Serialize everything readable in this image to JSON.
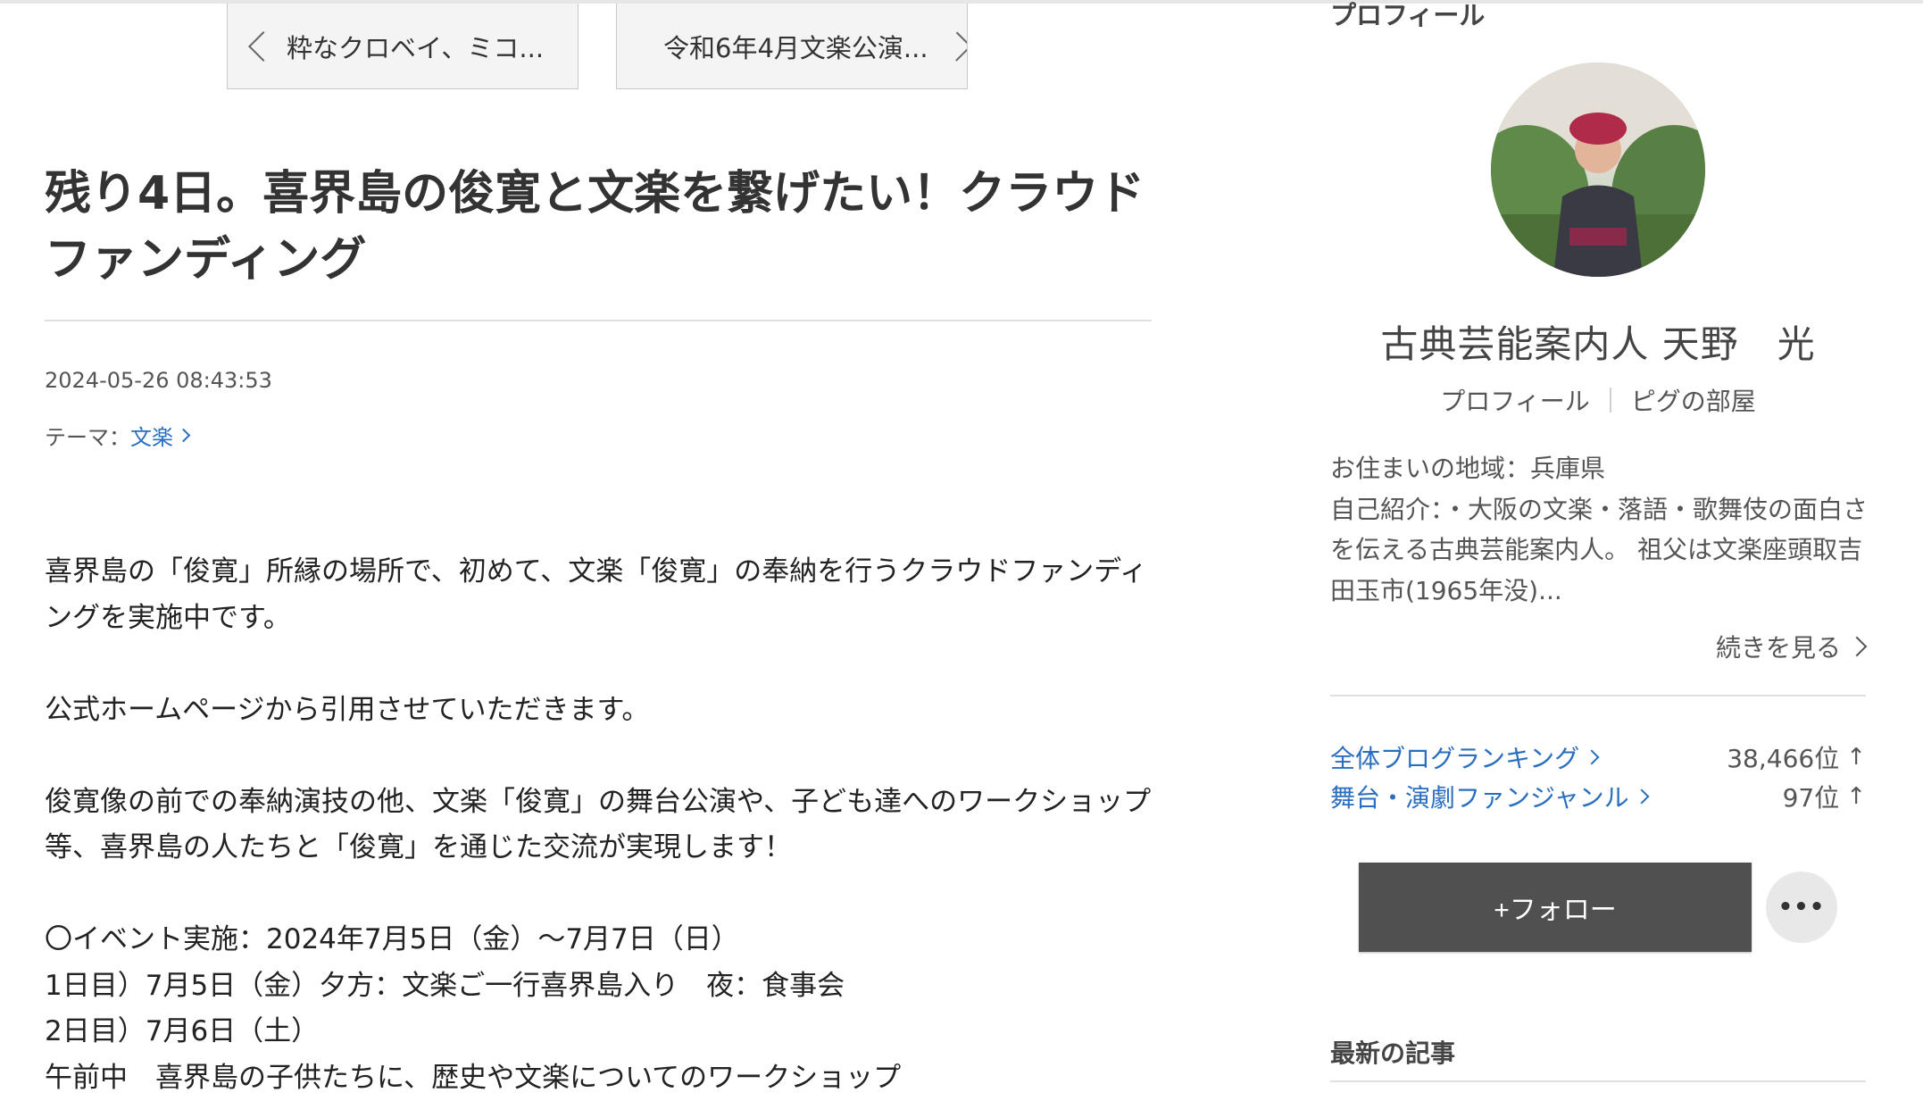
{
  "nav": {
    "prev_label": "粋なクロベイ、ミコ...",
    "next_label": "令和6年4月文楽公演..."
  },
  "article": {
    "title": "残り4日。喜界島の俊寛と文楽を繋げたい！クラウドファンディング",
    "date": "2024-05-26 08:43:53",
    "theme_prefix": "テーマ：",
    "theme_link": "文楽",
    "paragraphs": [
      "喜界島の「俊寛」所縁の場所で、初めて、文楽「俊寛」の奉納を行うクラウドファンディングを実施中です。",
      "",
      "公式ホームページから引用させていただきます。",
      "",
      "俊寛像の前での奉納演技の他、文楽「俊寛」の舞台公演や、子ども達へのワークショップ等、喜界島の人たちと「俊寛」を通じた交流が実現します！",
      "",
      "〇イベント実施：2024年7月5日（金）〜7月7日（日）",
      "1日目）7月5日（金）夕方：文楽ご一行喜界島入り　夜：食事会",
      "2日目）7月6日（土）",
      "午前中　喜界島の子供たちに、歴史や文楽についてのワークショップ"
    ]
  },
  "sidebar": {
    "heading": "プロフィール",
    "avatar_alt": "avatar",
    "name": "古典芸能案内人 天野　光",
    "links": [
      "プロフィール",
      "ピグの部屋"
    ],
    "residence": "お住まいの地域：兵庫県",
    "intro": "自己紹介：・大阪の文楽・落語・歌舞伎の面白さを伝える古典芸能案内人。 祖父は文楽座頭取吉田玉市(1965年没)...",
    "more_label": "続きを見る",
    "rankings": [
      {
        "label": "全体ブログランキング",
        "value": "38,466位",
        "arrow": "↑"
      },
      {
        "label": "舞台・演劇ファンジャンル",
        "value": "97位",
        "arrow": "↑"
      }
    ],
    "follow_label": "+フォロー",
    "menu_label": "•••",
    "latest_heading": "最新の記事"
  }
}
